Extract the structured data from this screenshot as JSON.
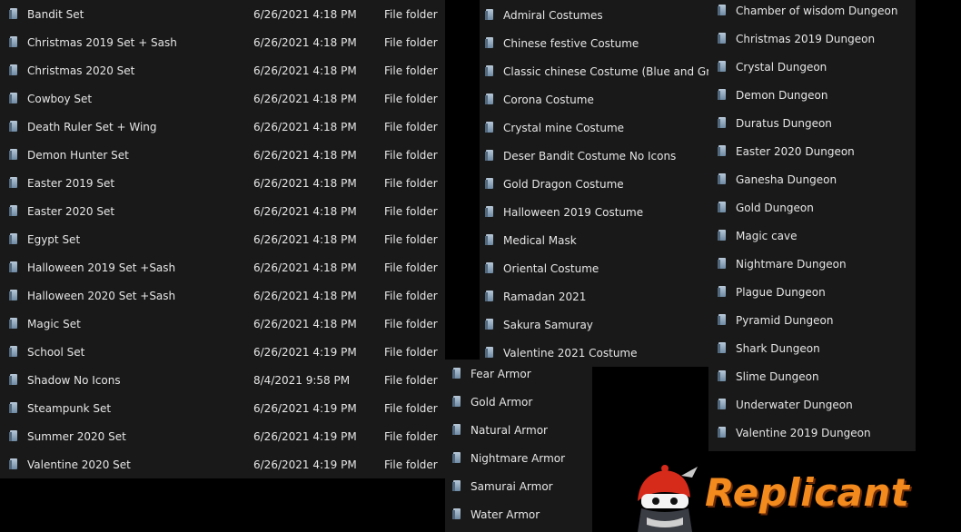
{
  "sets": [
    {
      "name": "Bandit Set",
      "date": "6/26/2021 4:18 PM",
      "type": "File folder"
    },
    {
      "name": "Christmas 2019 Set + Sash",
      "date": "6/26/2021 4:18 PM",
      "type": "File folder"
    },
    {
      "name": "Christmas 2020 Set",
      "date": "6/26/2021 4:18 PM",
      "type": "File folder"
    },
    {
      "name": "Cowboy Set",
      "date": "6/26/2021 4:18 PM",
      "type": "File folder"
    },
    {
      "name": "Death Ruler Set + Wing",
      "date": "6/26/2021 4:18 PM",
      "type": "File folder"
    },
    {
      "name": "Demon Hunter Set",
      "date": "6/26/2021 4:18 PM",
      "type": "File folder"
    },
    {
      "name": "Easter 2019 Set",
      "date": "6/26/2021 4:18 PM",
      "type": "File folder"
    },
    {
      "name": "Easter 2020 Set",
      "date": "6/26/2021 4:18 PM",
      "type": "File folder"
    },
    {
      "name": "Egypt Set",
      "date": "6/26/2021 4:18 PM",
      "type": "File folder"
    },
    {
      "name": "Halloween 2019 Set +Sash",
      "date": "6/26/2021 4:18 PM",
      "type": "File folder"
    },
    {
      "name": "Halloween 2020 Set +Sash",
      "date": "6/26/2021 4:18 PM",
      "type": "File folder"
    },
    {
      "name": "Magic Set",
      "date": "6/26/2021 4:18 PM",
      "type": "File folder"
    },
    {
      "name": "School Set",
      "date": "6/26/2021 4:19 PM",
      "type": "File folder"
    },
    {
      "name": "Shadow No Icons",
      "date": "8/4/2021 9:58 PM",
      "type": "File folder"
    },
    {
      "name": "Steampunk Set",
      "date": "6/26/2021 4:19 PM",
      "type": "File folder"
    },
    {
      "name": "Summer 2020 Set",
      "date": "6/26/2021 4:19 PM",
      "type": "File folder"
    },
    {
      "name": "Valentine 2020 Set",
      "date": "6/26/2021 4:19 PM",
      "type": "File folder"
    }
  ],
  "costumes": [
    "Admiral Costumes",
    "Chinese festive Costume",
    "Classic chinese Costume (Blue and Green)",
    "Corona Costume",
    "Crystal mine Costume",
    "Deser Bandit Costume No Icons",
    "Gold Dragon Costume",
    "Halloween 2019 Costume",
    "Medical Mask",
    "Oriental Costume",
    "Ramadan 2021",
    "Sakura Samuray",
    "Valentine 2021 Costume"
  ],
  "armors": [
    "Fear Armor",
    "Gold Armor",
    "Natural Armor",
    "Nightmare Armor",
    "Samurai Armor",
    "Water Armor"
  ],
  "dungeons": [
    "Chamber of wisdom Dungeon",
    "Christmas 2019 Dungeon",
    "Crystal Dungeon",
    "Demon Dungeon",
    "Duratus Dungeon",
    "Easter 2020 Dungeon",
    "Ganesha Dungeon",
    "Gold Dungeon",
    "Magic cave",
    "Nightmare Dungeon",
    "Plague Dungeon",
    "Pyramid Dungeon",
    "Shark Dungeon",
    "Slime Dungeon",
    "Underwater Dungeon",
    "Valentine 2019 Dungeon"
  ],
  "logo": {
    "text": "Replicant"
  },
  "colors": {
    "panel": "#191919",
    "text": "#e6e6e6",
    "logo": "#f28a1e"
  }
}
